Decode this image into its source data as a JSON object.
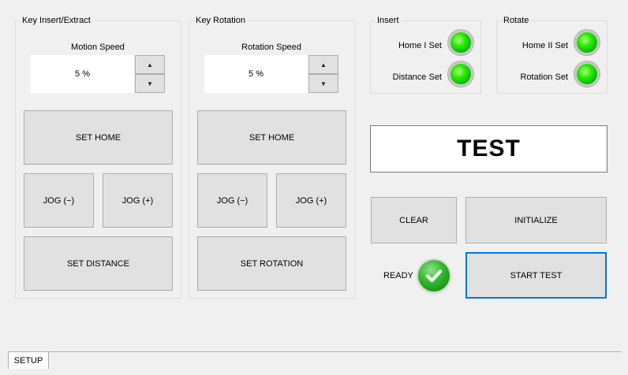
{
  "groups": {
    "insert_extract": {
      "title": "Key Insert/Extract",
      "speed_label": "Motion Speed",
      "speed_value": "5 %",
      "set_home": "SET HOME",
      "jog_minus": "JOG (−)",
      "jog_plus": "JOG (+)",
      "set_action": "SET DISTANCE"
    },
    "rotation": {
      "title": "Key Rotation",
      "speed_label": "Rotation Speed",
      "speed_value": "5 %",
      "set_home": "SET HOME",
      "jog_minus": "JOG (−)",
      "jog_plus": "JOG (+)",
      "set_action": "SET ROTATION"
    }
  },
  "insert_status": {
    "title": "Insert",
    "home_label": "Home I Set",
    "distance_label": "Distance Set"
  },
  "rotate_status": {
    "title": "Rotate",
    "home_label": "Home II Set",
    "rotation_label": "Rotation Set"
  },
  "display": {
    "text": "TEST"
  },
  "actions": {
    "clear": "CLEAR",
    "initialize": "INITIALIZE",
    "ready_label": "READY",
    "start_test": "START TEST"
  },
  "tabs": [
    "SETUP"
  ],
  "spin": {
    "up": "▲",
    "down": "▼"
  },
  "colors": {
    "led_on": "#22e000",
    "accent": "#0078d7",
    "ready_check": "#2fb72a"
  },
  "icons": {
    "led": "status-led-icon",
    "ready": "check-circle-icon"
  }
}
